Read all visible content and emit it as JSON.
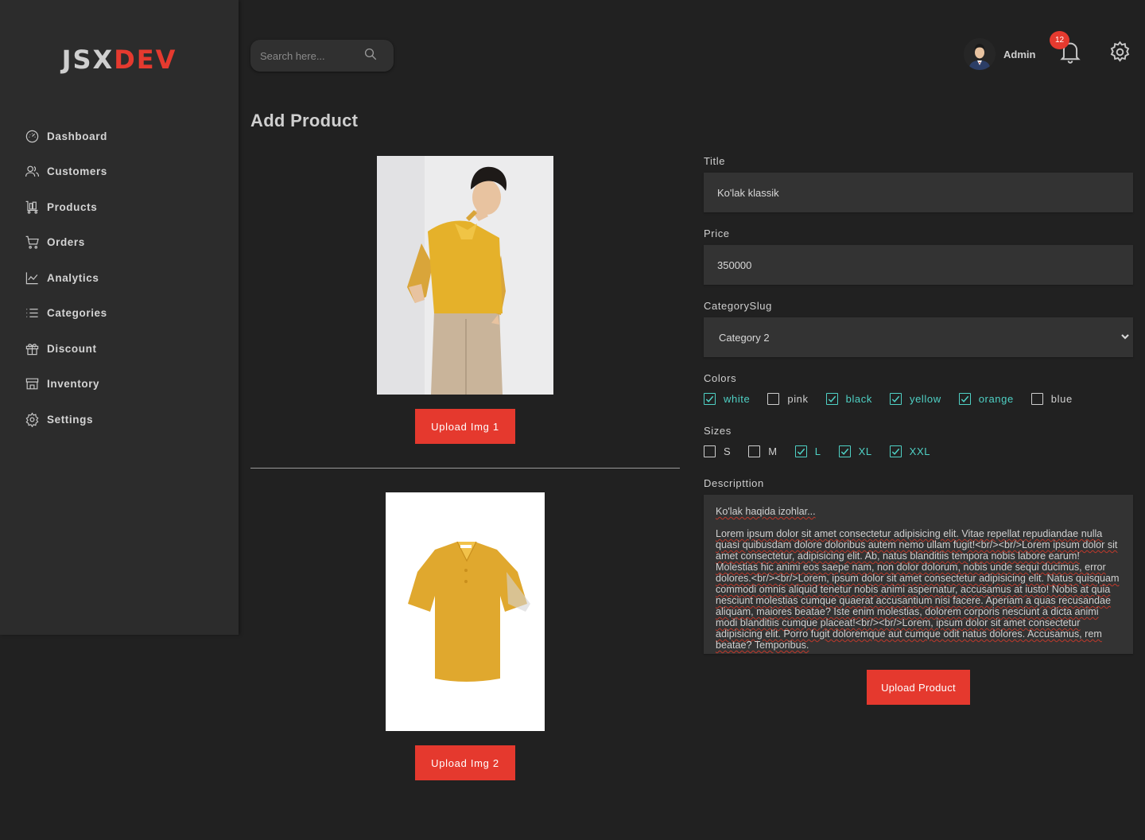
{
  "brand": {
    "part1": "JSX",
    "part2": "DEV"
  },
  "sidebar": {
    "items": [
      {
        "label": "Dashboard",
        "icon": "dashboard-gauge-icon"
      },
      {
        "label": "Customers",
        "icon": "users-icon"
      },
      {
        "label": "Products",
        "icon": "cart-trolley-icon"
      },
      {
        "label": "Orders",
        "icon": "shopping-cart-icon"
      },
      {
        "label": "Analytics",
        "icon": "line-chart-icon"
      },
      {
        "label": "Categories",
        "icon": "list-icon"
      },
      {
        "label": "Discount",
        "icon": "gift-icon"
      },
      {
        "label": "Inventory",
        "icon": "store-icon"
      },
      {
        "label": "Settings",
        "icon": "gear-icon"
      }
    ]
  },
  "header": {
    "search_placeholder": "Search here...",
    "user_name": "Admin",
    "notification_count": "12"
  },
  "page": {
    "title": "Add Product"
  },
  "images": {
    "upload1_label": "Upload Img 1",
    "upload2_label": "Upload Img 2"
  },
  "form": {
    "title_label": "Title",
    "title_value": "Ko'lak klassik",
    "price_label": "Price",
    "price_value": "350000",
    "category_label": "CategorySlug",
    "category_value": "Category 2",
    "colors_label": "Colors",
    "colors": [
      {
        "label": "white",
        "checked": true
      },
      {
        "label": "pink",
        "checked": false
      },
      {
        "label": "black",
        "checked": true
      },
      {
        "label": "yellow",
        "checked": true
      },
      {
        "label": "orange",
        "checked": true
      },
      {
        "label": "blue",
        "checked": false
      }
    ],
    "sizes_label": "Sizes",
    "sizes": [
      {
        "label": "S",
        "checked": false
      },
      {
        "label": "M",
        "checked": false
      },
      {
        "label": "L",
        "checked": true
      },
      {
        "label": "XL",
        "checked": true
      },
      {
        "label": "XXL",
        "checked": true
      }
    ],
    "description_label": "Descripttion",
    "description_line1": "Ko'lak haqida izohlar...",
    "description_body": "Lorem ipsum dolor sit amet consectetur adipisicing elit. Vitae repellat repudiandae nulla quasi quibusdam dolore doloribus autem nemo ullam fugit!<br/><br/>Lorem ipsum dolor sit amet consectetur, adipisicing elit. Ab, natus blanditiis tempora nobis labore earum! Molestias hic animi eos saepe nam, non dolor dolorum, nobis unde sequi ducimus, error dolores.<br/><br/>Lorem, ipsum dolor sit amet consectetur adipisicing elit. Natus quisquam commodi omnis aliquid tenetur nobis animi aspernatur, accusamus at iusto! Nobis at quia nesciunt molestias cumque quaerat accusantium nisi facere. Aperiam a quas recusandae aliquam, maiores beatae? Iste enim molestias, dolorem corporis nesciunt a dicta animi modi blanditiis cumque placeat!<br/><br/>Lorem, ipsum dolor sit amet consectetur adipisicing elit. Porro fugit doloremque aut cumque odit natus dolores. Accusamus, rem beatae? Temporibus.",
    "submit_label": "Upload Product"
  },
  "colors": {
    "accent_red": "#e53a2f",
    "check_teal": "#4fd1c5",
    "background": "#212121",
    "sidebar": "#2c2c2c"
  }
}
